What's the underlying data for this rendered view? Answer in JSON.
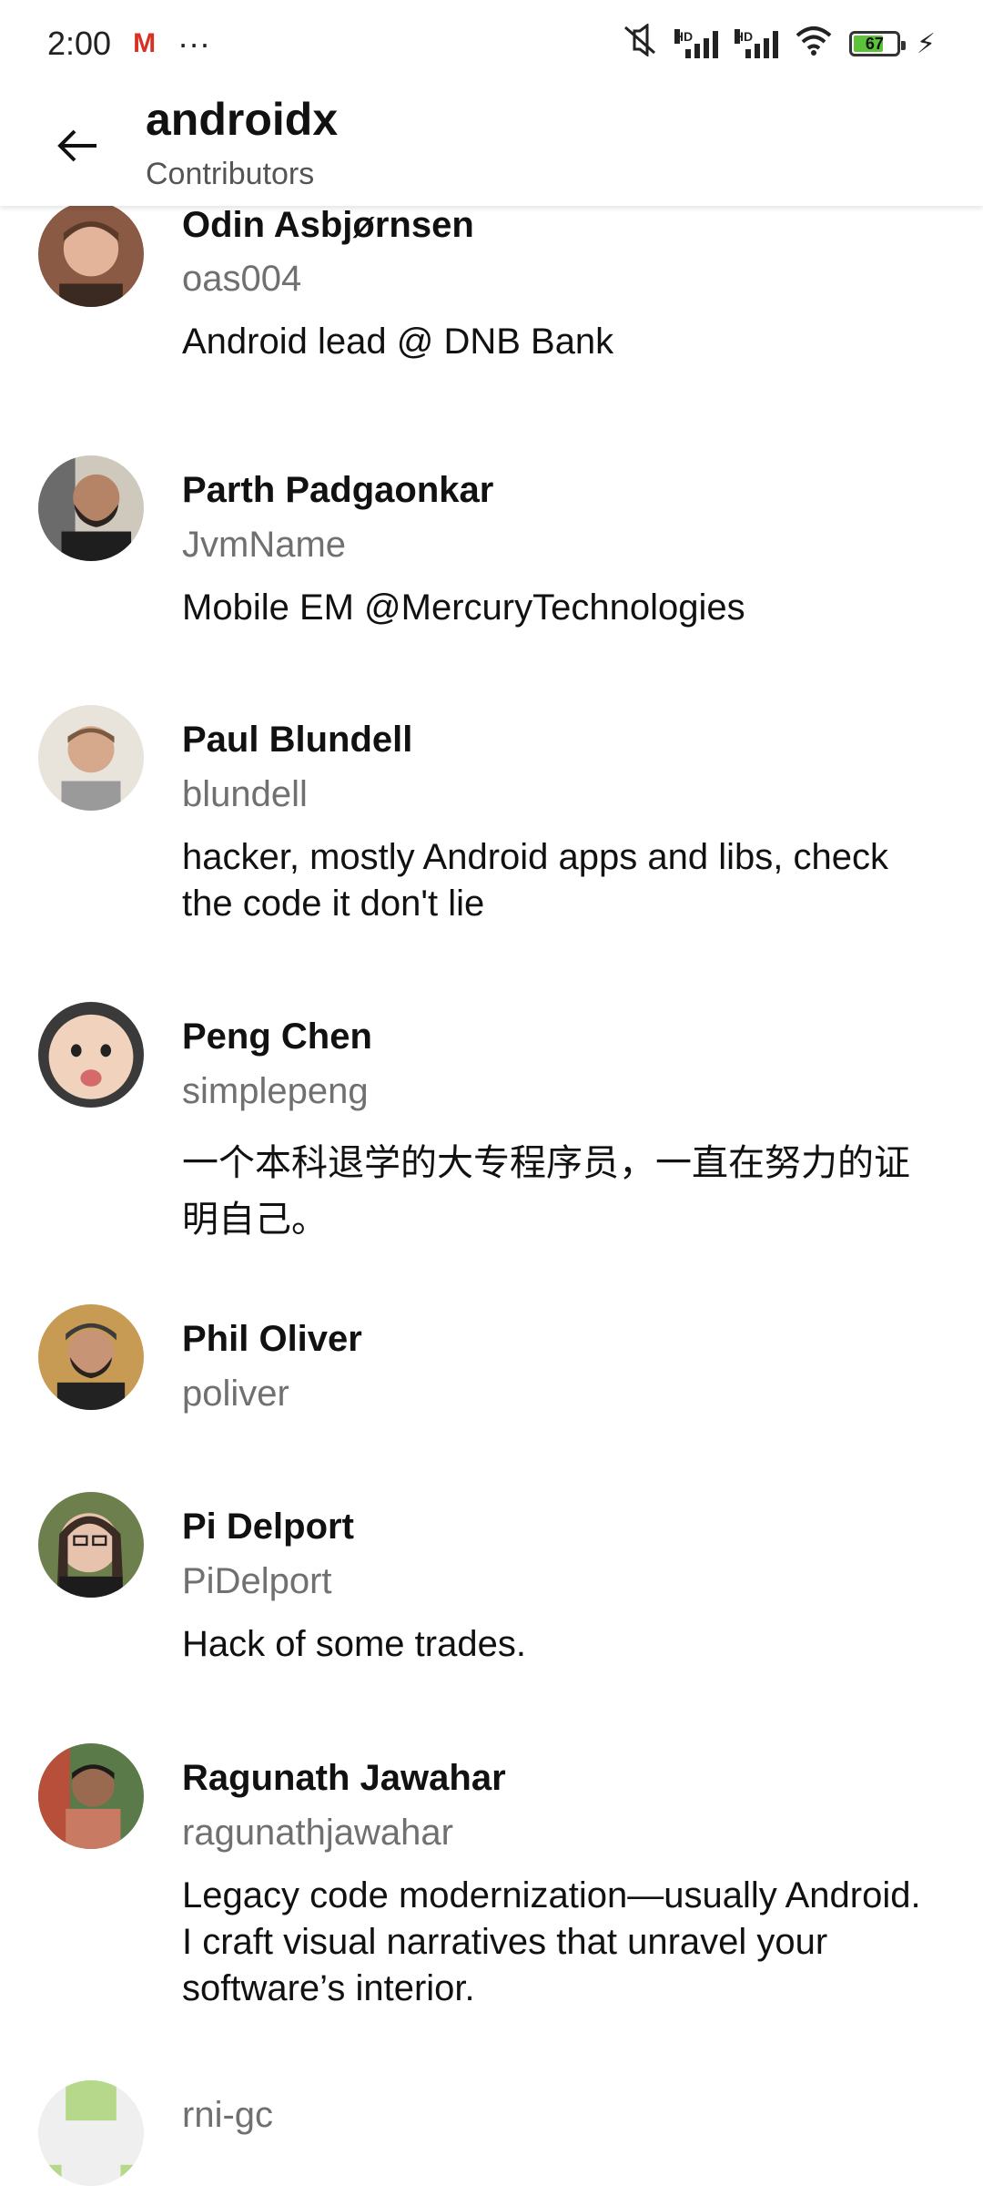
{
  "status_bar": {
    "time": "2:00",
    "notification_icon": "gmail-icon",
    "more": "···",
    "battery_level": "67"
  },
  "app_bar": {
    "title": "androidx",
    "subtitle": "Contributors"
  },
  "contributors": [
    {
      "name": "Odin Asbjørnsen",
      "login": "oas004",
      "bio": "Android lead @ DNB Bank"
    },
    {
      "name": "Parth Padgaonkar",
      "login": "JvmName",
      "bio": "Mobile EM @MercuryTechnologies"
    },
    {
      "name": "Paul Blundell",
      "login": "blundell",
      "bio": "hacker, mostly Android apps and libs, check the code it don't lie"
    },
    {
      "name": "Peng Chen",
      "login": "simplepeng",
      "bio": "一个本科退学的大专程序员，一直在努力的证明自己。"
    },
    {
      "name": "Phil Oliver",
      "login": "poliver",
      "bio": ""
    },
    {
      "name": "Pi Delport",
      "login": "PiDelport",
      "bio": "Hack of some trades."
    },
    {
      "name": "Ragunath Jawahar",
      "login": "ragunathjawahar",
      "bio": "Legacy code modernization—usually Android. I craft visual narratives that unravel your software’s interior."
    },
    {
      "name": "",
      "login": "rni-gc",
      "bio": ""
    }
  ]
}
